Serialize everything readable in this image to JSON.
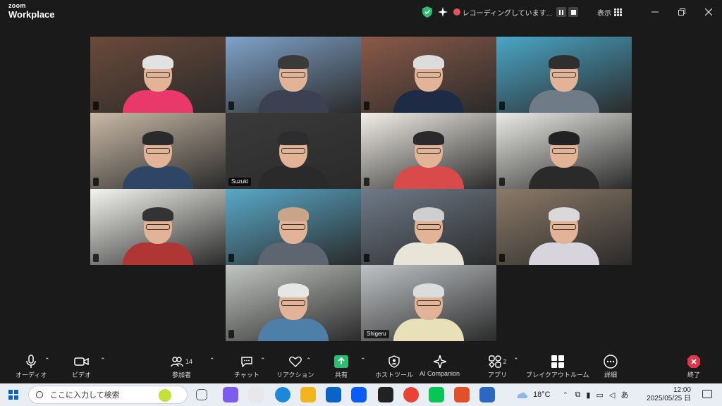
{
  "title_bar": {
    "brand_small": "zoom",
    "brand_big": "Workplace",
    "recording_text": "レコーディングしています...",
    "view_label": "表示"
  },
  "tiles": [
    {
      "name": "",
      "bg": "#6b4a3a",
      "shirt": "#e8396a",
      "hair": "#e2e2e2"
    },
    {
      "name": "",
      "bg": "#7fa3c9",
      "shirt": "#3b4150",
      "hair": "#3a3a3a"
    },
    {
      "name": "",
      "bg": "#8a5a48",
      "shirt": "#1e2b44",
      "hair": "#dcdcdc"
    },
    {
      "name": "",
      "bg": "#4aa6c6",
      "shirt": "#6f7b86",
      "hair": "#2f2f2f"
    },
    {
      "name": "",
      "bg": "#c9b9a6",
      "shirt": "#2f4566",
      "hair": "#2a2a2a"
    },
    {
      "name": "Suzuki",
      "bg": "#3a3a3a",
      "shirt": "#2a2a2a",
      "hair": "#2d2d2d"
    },
    {
      "name": "",
      "bg": "#f3efe8",
      "shirt": "#d94a4a",
      "hair": "#2a2a2a"
    },
    {
      "name": "",
      "bg": "#ebebe6",
      "shirt": "#2a2a2a",
      "hair": "#222"
    },
    {
      "name": "",
      "bg": "#f5f5f0",
      "shirt": "#b03636",
      "hair": "#333"
    },
    {
      "name": "",
      "bg": "#59a9c9",
      "shirt": "#5d6670",
      "hair": "#c9a488"
    },
    {
      "name": "",
      "bg": "#6f7a88",
      "shirt": "#e9e4d8",
      "hair": "#cfcfcf"
    },
    {
      "name": "",
      "bg": "#8c7a68",
      "shirt": "#d8d4de",
      "hair": "#d9d9d9"
    },
    {
      "name": "",
      "bg": "#c2c6c2",
      "shirt": "#4d7fa8",
      "hair": "#e6e6e6"
    },
    {
      "name": "Shigeru",
      "bg": "#bfc3c6",
      "shirt": "#e8e0b8",
      "hair": "#dcdcdc"
    }
  ],
  "toolbar": {
    "audio": "オーディオ",
    "video": "ビデオ",
    "participants": "参加者",
    "participants_count": "14",
    "chat": "チャット",
    "reactions": "リアクション",
    "share": "共有",
    "host_tools": "ホストツール",
    "ai_companion": "AI Companion",
    "apps": "アプリ",
    "apps_count": "2",
    "breakout": "ブレイクアウトルーム",
    "more": "詳細",
    "end": "終了"
  },
  "taskbar": {
    "search_placeholder": "ここに入力して検索",
    "weather": "18°C",
    "ime": "あ",
    "time": "12:00",
    "date": "2025/05/25 日"
  },
  "colors": {
    "accent_green": "#2dbd6e",
    "end_red": "#e0364a"
  }
}
